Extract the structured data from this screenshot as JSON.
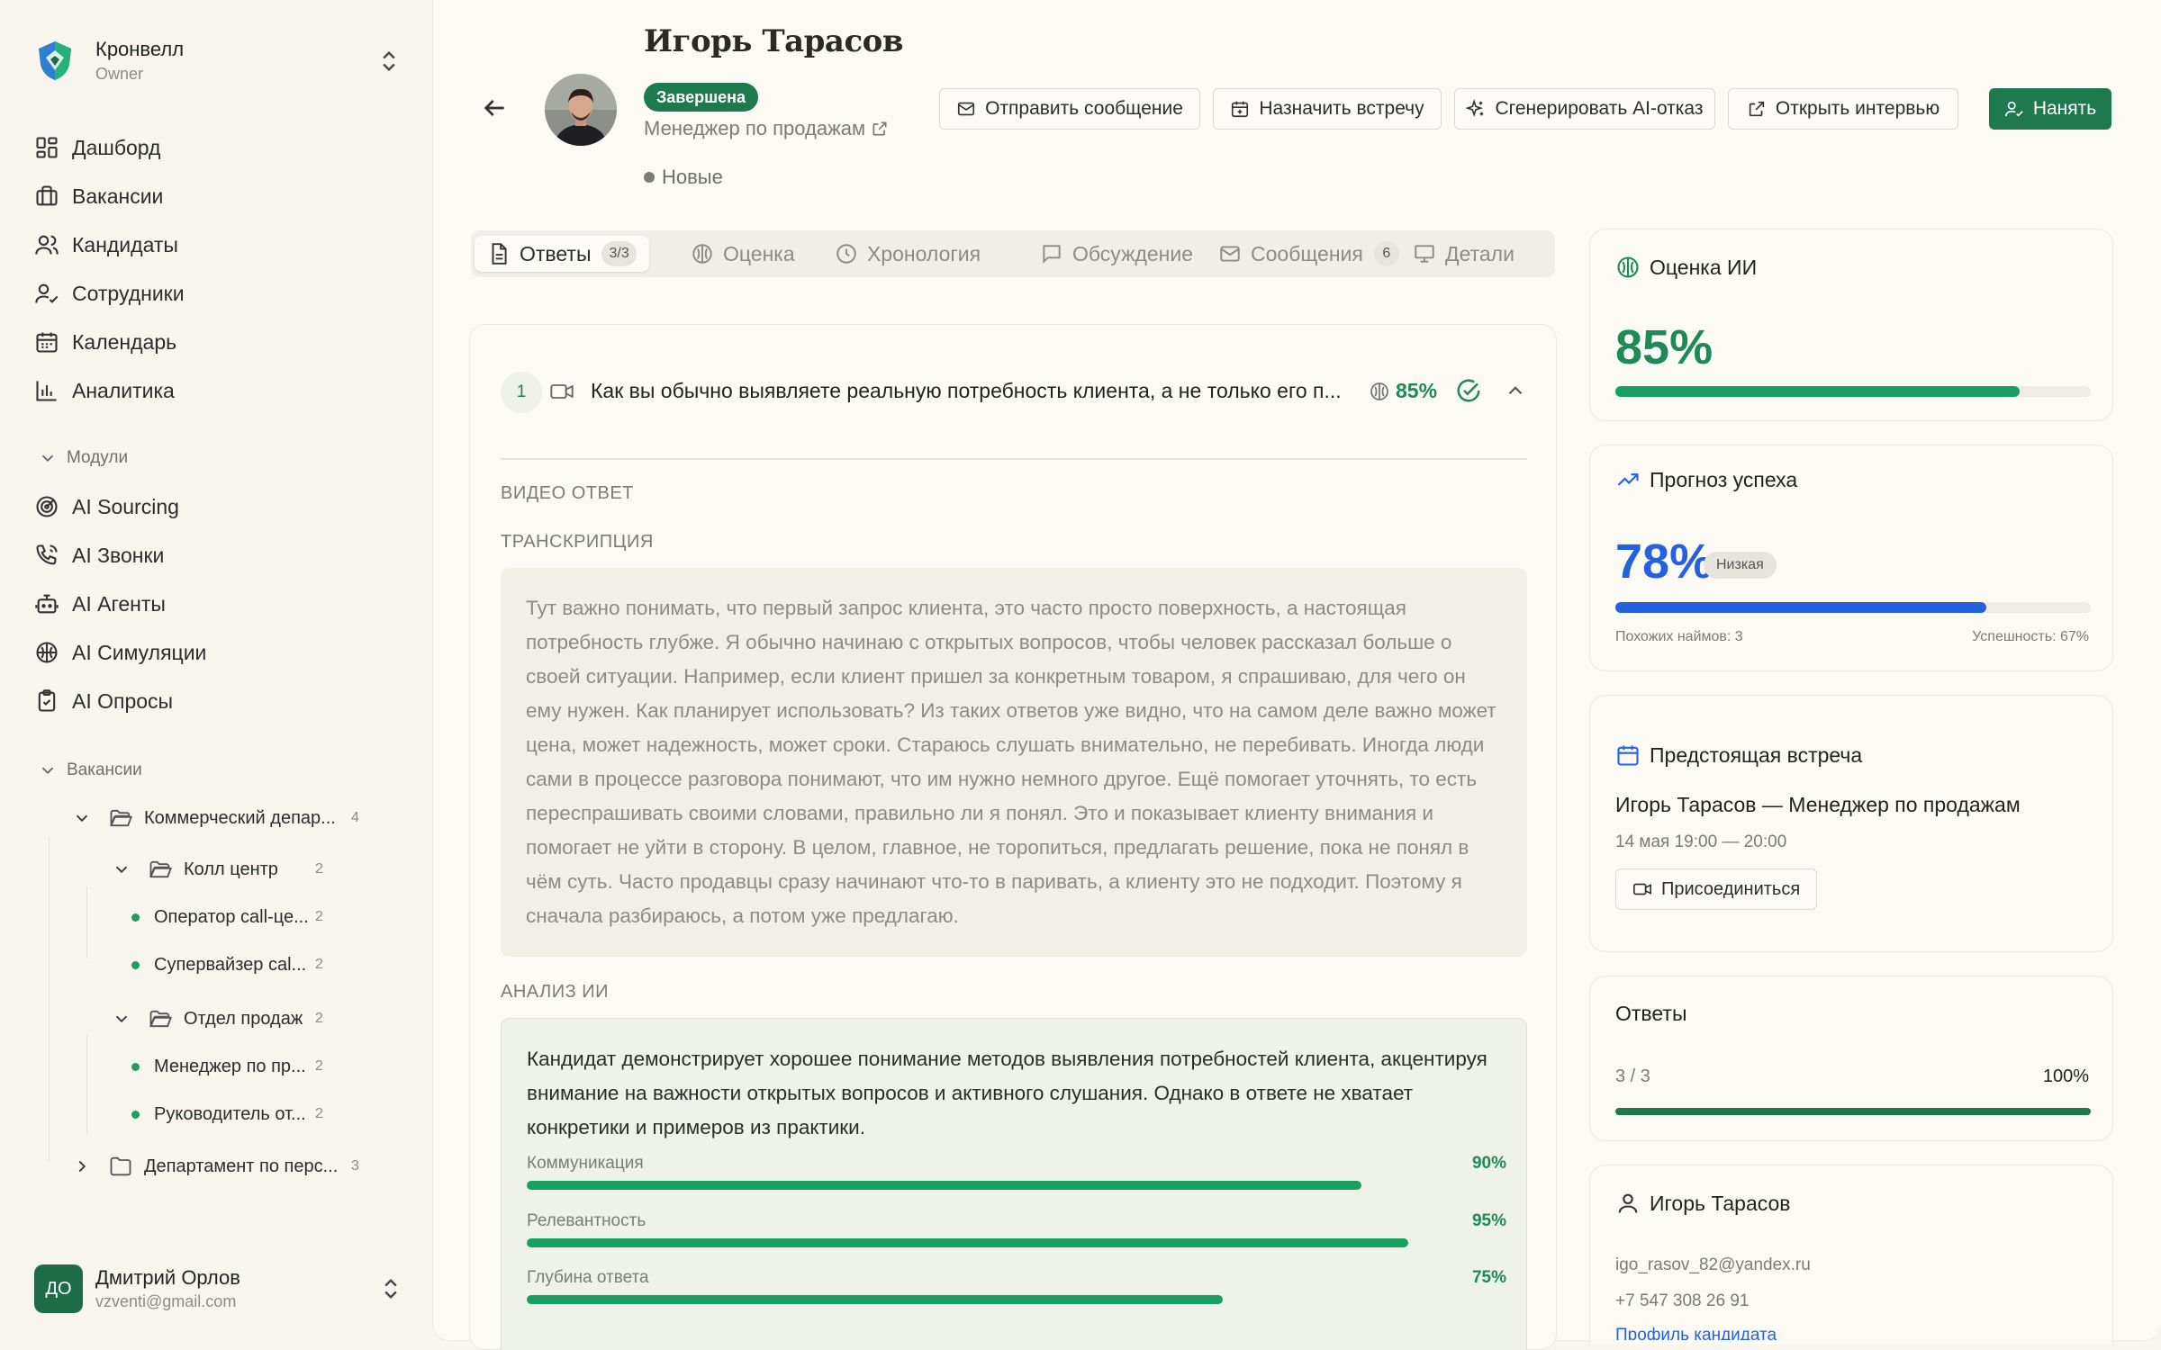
{
  "org": {
    "name": "Кронвелл",
    "role": "Owner"
  },
  "nav": [
    {
      "label": "Дашборд",
      "icon": "dashboard-icon"
    },
    {
      "label": "Вакансии",
      "icon": "briefcase-icon"
    },
    {
      "label": "Кандидаты",
      "icon": "users-icon"
    },
    {
      "label": "Сотрудники",
      "icon": "user-check-icon"
    },
    {
      "label": "Календарь",
      "icon": "calendar-icon"
    },
    {
      "label": "Аналитика",
      "icon": "bar-chart-icon"
    }
  ],
  "modules": {
    "title": "Модули",
    "items": [
      {
        "label": "AI Sourcing",
        "icon": "target-icon"
      },
      {
        "label": "AI Звонки",
        "icon": "phone-icon"
      },
      {
        "label": "AI Агенты",
        "icon": "bot-icon"
      },
      {
        "label": "AI Симуляции",
        "icon": "brain-icon"
      },
      {
        "label": "AI Опросы",
        "icon": "clipboard-icon"
      }
    ]
  },
  "vacancies": {
    "title": "Вакансии",
    "tree": [
      {
        "label": "Коммерческий депар...",
        "count": "4"
      },
      {
        "label": "Колл центр",
        "count": "2"
      },
      {
        "label": "Оператор call-це...",
        "count": "2"
      },
      {
        "label": "Супервайзер cal...",
        "count": "2"
      },
      {
        "label": "Отдел продаж",
        "count": "2"
      },
      {
        "label": "Менеджер по пр...",
        "count": "2"
      },
      {
        "label": "Руководитель от...",
        "count": "2"
      },
      {
        "label": "Департамент по перс...",
        "count": "3"
      }
    ]
  },
  "user": {
    "initials": "ДО",
    "name": "Дмитрий Орлов",
    "email": "vzventi@gmail.com"
  },
  "candidate": {
    "name": "Игорь Тарасов",
    "status": "Завершена",
    "position": "Менеджер по продажам",
    "stage": "Новые"
  },
  "actions": {
    "send_message": "Отправить сообщение",
    "schedule": "Назначить встречу",
    "ai_reject": "Сгенерировать AI-отказ",
    "open_interview": "Открыть интервью",
    "hire": "Нанять"
  },
  "tabs": [
    {
      "label": "Ответы",
      "badge": "3/3"
    },
    {
      "label": "Оценка"
    },
    {
      "label": "Хронология"
    },
    {
      "label": "Обсуждение"
    },
    {
      "label": "Сообщения",
      "badge": "6"
    },
    {
      "label": "Детали"
    }
  ],
  "question": {
    "number": "1",
    "text": "Как вы обычно выявляете реальную потребность клиента, а не только его п...",
    "score": "85%",
    "video_label": "ВИДЕО ОТВЕТ",
    "transcript_label": "ТРАНСКРИПЦИЯ",
    "transcript": "Тут важно понимать, что первый запрос клиента, это часто просто поверхность, а настоящая потребность глубже. Я обычно начинаю с открытых вопросов, чтобы человек рассказал больше о своей ситуации. Например, если клиент пришел за конкретным товаром, я спрашиваю, для чего он ему нужен. Как планирует использовать? Из таких ответов уже видно, что на самом деле важно может цена, может надежность, может сроки. Стараюсь слушать внимательно, не перебивать. Иногда люди сами в процессе разговора понимают, что им нужно немного другое. Ещё помогает уточнять, то есть переспрашивать своими словами, правильно ли я понял. Это и показывает клиенту внимания и помогает не уйти в сторону. В целом, главное, не торопиться, предлагать решение, пока не понял в чём суть. Часто продавцы сразу начинают что-то в паривать, а клиенту это не подходит. Поэтому я сначала разбираюсь, а потом уже предлагаю.",
    "analysis_label": "АНАЛИЗ ИИ",
    "analysis": "Кандидат демонстрирует хорошее понимание методов выявления потребностей клиента, акцентируя внимание на важности открытых вопросов и активного слушания. Однако в ответе не хватает конкретики и примеров из практики.",
    "metrics": [
      {
        "label": "Коммуникация",
        "value": "90%",
        "fraction": 0.9
      },
      {
        "label": "Релевантность",
        "value": "95%",
        "fraction": 0.95
      },
      {
        "label": "Глубина ответа",
        "value": "75%",
        "fraction": 0.75
      }
    ]
  },
  "ai_score": {
    "title": "Оценка ИИ",
    "value": "85%",
    "fraction": 0.85,
    "color": "#1e8a55"
  },
  "forecast": {
    "title": "Прогноз успеха",
    "value": "78%",
    "fraction": 0.78,
    "level": "Низкая",
    "similar": "Похожих наймов: 3",
    "success": "Успешность: 67%",
    "color": "#2461e0"
  },
  "meeting": {
    "title": "Предстоящая встреча",
    "subject": "Игорь Тарасов — Менеджер по продажам",
    "time": "14 мая 19:00 — 20:00",
    "join": "Присоединиться"
  },
  "answers": {
    "title": "Ответы",
    "count": "3 / 3",
    "percent": "100%",
    "fraction": 1.0
  },
  "contact": {
    "name": "Игорь Тарасов",
    "email": "igo_rasov_82@yandex.ru",
    "phone": "+7 547 308 26 91",
    "profile_link": "Профиль кандидата"
  }
}
